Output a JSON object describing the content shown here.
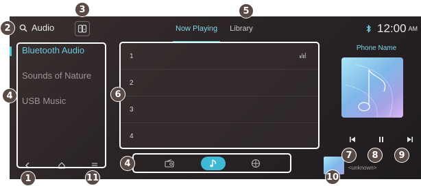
{
  "topbar": {
    "app_title": "Audio",
    "tabs": [
      {
        "label": "Now Playing",
        "active": true
      },
      {
        "label": "Library",
        "active": false
      }
    ],
    "clock": "12:00",
    "ampm": "AM"
  },
  "sidebar": {
    "items": [
      {
        "label": "Bluetooth Audio",
        "active": true
      },
      {
        "label": "Sounds of Nature",
        "active": false
      },
      {
        "label": "USB Music",
        "active": false
      }
    ]
  },
  "tracklist": {
    "rows": [
      "1",
      "2",
      "3",
      "4"
    ],
    "playing_index": 0
  },
  "nowplaying": {
    "phone_name": "Phone Name",
    "mini_label": "<unknown>"
  },
  "callouts": {
    "back": "1",
    "search": "2",
    "source_switch": "3",
    "sidebar_list": "4",
    "dock": "4",
    "tabs": "5",
    "track_list": "6",
    "prev": "7",
    "pause": "8",
    "next": "9",
    "mini_player": "10",
    "menu": "11"
  },
  "colors": {
    "accent": "#4ec7e5",
    "accent_text": "#7fd6ea",
    "background": "#2b2425",
    "callout": "#5a4a46",
    "highlight_frame": "#ffffff"
  },
  "icons": {
    "search": "search-icon",
    "source": "source-switch-icon",
    "bluetooth_status": "bluetooth-status-icon",
    "eq": "equalizer-icon",
    "prev": "previous-icon",
    "pause": "pause-icon",
    "next": "next-icon",
    "back": "back-icon",
    "home": "home-icon",
    "menu": "menu-icon",
    "radio": "radio-icon",
    "music": "music-note-icon",
    "apps": "apps-icon"
  }
}
